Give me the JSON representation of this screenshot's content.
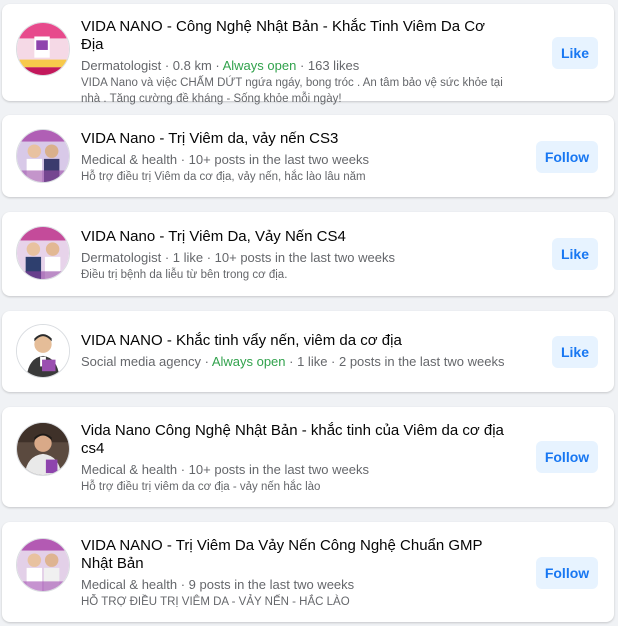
{
  "results": [
    {
      "title": "VIDA NANO - Công Nghệ Nhật Bản - Khắc Tinh Viêm Da Cơ Địa",
      "category": "Dermatologist",
      "meta_parts": [
        {
          "text": " · 0.8 km · "
        },
        {
          "text": "Always open",
          "open": true
        },
        {
          "text": " · 163 likes"
        }
      ],
      "description": "VIDA Nano và việc CHẤM DỨT ngứa ngáy, bong tróc . An tâm bảo vệ sức khỏe tại nhà . Tăng cường đề kháng - Sống khỏe mỗi ngày!",
      "button": "Like",
      "avatar": "product-ad-avatar"
    },
    {
      "title": "VIDA Nano - Trị Viêm da, vảy nến CS3",
      "category": "Medical & health",
      "meta_parts": [
        {
          "text": " · 10+ posts in the last two weeks"
        }
      ],
      "description": "Hỗ trợ điều trị Viêm da cơ địa, vảy nến, hắc lào lâu năm",
      "button": "Follow",
      "avatar": "people-avatar"
    },
    {
      "title": "VIDA Nano - Trị Viêm Da, Vảy Nến CS4",
      "category": "Dermatologist",
      "meta_parts": [
        {
          "text": " · 1 like · 10+ posts in the last two weeks"
        }
      ],
      "description": "Điều trị bệnh da liễu từ bên trong cơ địa.",
      "button": "Like",
      "avatar": "people-avatar"
    },
    {
      "title": "VIDA NANO - Khắc tinh vẩy nến, viêm da cơ địa",
      "category": "Social media agency",
      "meta_parts": [
        {
          "text": " · "
        },
        {
          "text": "Always open",
          "open": true
        },
        {
          "text": " · 1 like · 2 posts in the last two weeks"
        }
      ],
      "description": "",
      "button": "Like",
      "avatar": "man-portrait-avatar"
    },
    {
      "title": "Vida Nano Công Nghệ Nhật Bản - khắc tinh của Viêm da cơ địa cs4",
      "category": "Medical & health",
      "meta_parts": [
        {
          "text": " · 10+ posts in the last two weeks"
        }
      ],
      "description": "Hỗ trợ điều trị viêm da cơ địa - vảy nến hắc lào",
      "button": "Follow",
      "avatar": "man-photo-avatar"
    },
    {
      "title": "VIDA NANO - Trị Viêm Da Vảy Nến Công Nghệ Chuẩn GMP Nhật Bản",
      "category": "Medical & health",
      "meta_parts": [
        {
          "text": " · 9 posts in the last two weeks"
        }
      ],
      "description": "HỖ TRỢ ĐIỀU TRỊ VIÊM DA - VẢY NẾN - HẮC LÀO",
      "button": "Follow",
      "avatar": "people-avatar"
    }
  ],
  "colors": {
    "background": "#f0f2f5",
    "card": "#ffffff",
    "title": "#050505",
    "secondary_text": "#65676b",
    "open_status": "#31a24c",
    "button_bg": "#e7f3ff",
    "button_text": "#1877f2"
  }
}
